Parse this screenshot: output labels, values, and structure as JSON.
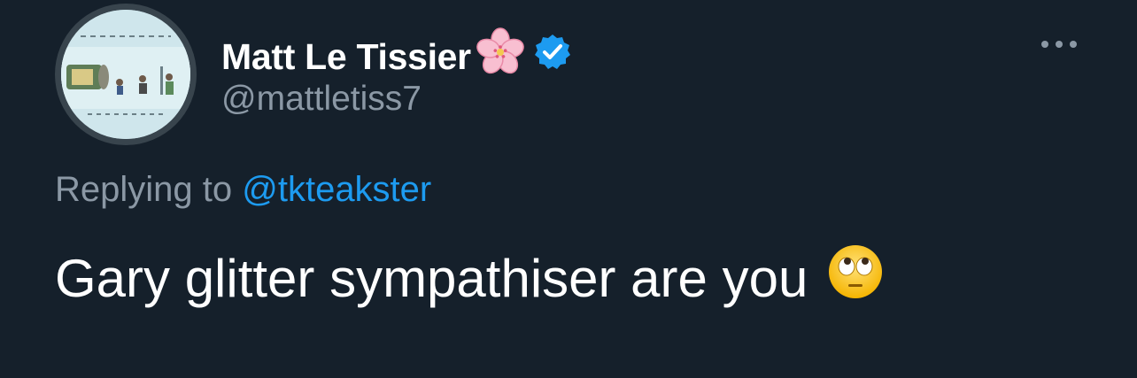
{
  "tweet": {
    "display_name": "Matt Le Tissier",
    "handle": "@mattletiss7",
    "replying_prefix": "Replying to ",
    "replying_to": "@tkteakster",
    "text": "Gary glitter sympathiser are you",
    "name_emoji_icon": "cherry-blossom-icon",
    "verified_icon": "verified-badge-icon",
    "text_emoji_icon": "face-with-rolling-eyes-icon",
    "more_icon": "more-options-icon"
  },
  "colors": {
    "background": "#15202b",
    "primary_text": "#ffffff",
    "secondary_text": "#8b98a5",
    "link": "#1d9bf0",
    "verified": "#1d9bf0"
  }
}
